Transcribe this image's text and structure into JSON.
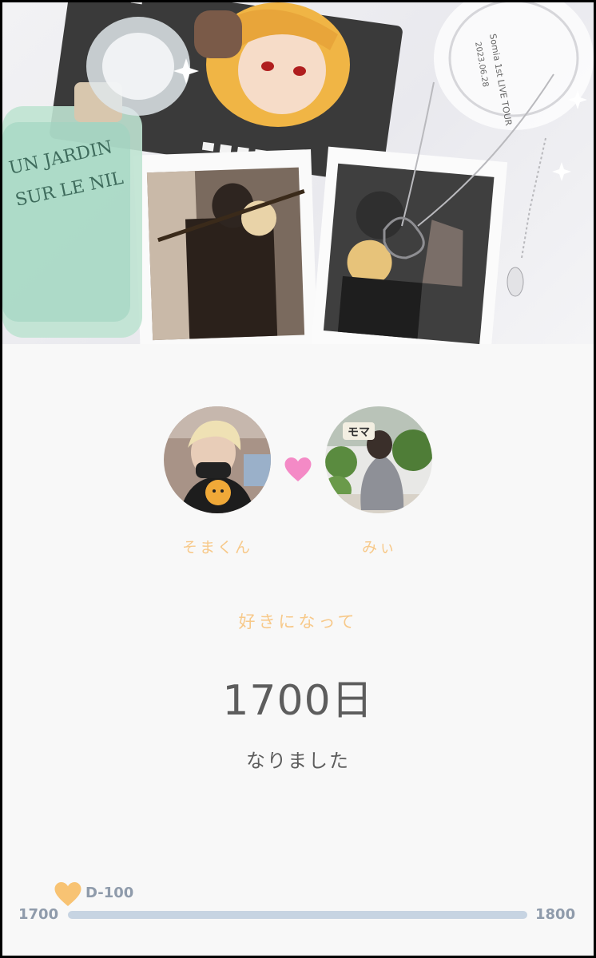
{
  "hero": {
    "perfume_label_line1": "UN JARDIN",
    "perfume_label_line2": "SUR LE NIL",
    "glass_text": "Somia 1st LIVE TOUR",
    "glass_text2": "2023.06.28"
  },
  "couple": {
    "left_name": "そまくん",
    "right_name": "みぃ",
    "sign_text": "モマ"
  },
  "counter": {
    "caption": "好きになって",
    "days": "1700日",
    "suffix": "なりました"
  },
  "progress": {
    "start_label": "1700",
    "end_label": "1800",
    "marker_label": "D-100",
    "value": 1700,
    "min": 1700,
    "max": 1800
  },
  "colors": {
    "accent": "#f7c98a",
    "heart_pink": "#f48ac6",
    "heart_gold": "#f8c373",
    "text": "#5d5d5d",
    "track": "#c7d4e2"
  }
}
